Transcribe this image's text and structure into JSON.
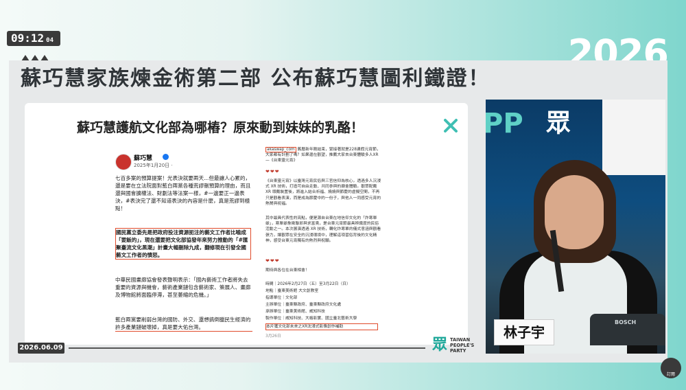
{
  "clock": {
    "time": "09:12",
    "seconds": "04"
  },
  "year_logo": "2026",
  "headline": "蘇巧慧家族煉金術第二部 公布蘇巧慧圖利鐵證！",
  "card": {
    "title": "蘇巧慧護航文化部為哪樁？原來動到妹妹的乳酪！",
    "close_icon": "close-icon",
    "fb_post": {
      "author": "蘇巧慧",
      "date": "2025年1月20日 · ",
      "p1": "七百多案的預算提案！光表決就要兩天...但最讓人心累的，還是要在立法院面對藍白兩黨各種荒謬刪預算的理由，而且還與國會擴權法、財劃法等法案一樣，#一邊要正一邊表決，#表決完了還不知道表決的內容是什麼，真是荒謬到極點！",
      "p2": "國民黨立委先是把政府投注資源扼注的藝文工作者比喻成「要飯的」，現在還要把文化部協發年來努力推動的「#匯聚臺流文化黑潮」計畫大幅刪除九成，翻修現在引發全國藝文工作者的憤怒。",
      "p3": "中華民國畫廊協會發表聲明表示：「國內藝術工作者將失去重要的資源與機會，藝術產業鏈包含藝術家、策展人、畫廊及博物館將面臨停滯，甚至萎縮的危機。」",
      "p4": "藍白兩黨要削弱台灣的國防、外交、還想搞倒臘民生經濟的許多產業鏈破壞掉，真是要大佑台灣。"
    },
    "event_post": {
      "link": "akaswap_com",
      "intro": "舊曆新年剛結束，緊接著就是228連假元宵節，大家都有計劃了嗎？如果還在觀望，推薦大家去台東體驗多人XR—《台東靈元宵》",
      "hearts": "❤❤❤",
      "desc1": "《台東靈元宵》以臺灣元宵民俗與三官信仰為核心，透過多人沉浸式 XR 技術，打造可自由走動、共同參與的廟會體驗。觀眾配戴 XR 頭戴裝置後，將進入結合祈福、燒燒與節慶的虛擬空間，不再只是觀看表演，而是成為節慶中的一份子，與他人一同感受元宵的熱鬧與祝福。",
      "desc2": "其中最具代表性的亮點，便是源自台東在地信仰文化的「炸寒單爺」，寒單爺象徵聯邪與求富貴，是台東元宵節最具辨識度的民俗活動之一。本次展演透過 XR 技術，轉化炸寒單的儀式意涵與觀看張力，讓觀眾在安全的沉浸環境中，理解這項習俗背後的文化精神，感受台東元宵獨有的熱烈與祝願。",
      "hearts2": "❤❤❤",
      "cta": "期待與各位在台東相會！",
      "schedule": "時間｜2026年2月27日（五）至3月22日（日）",
      "venue": "地點｜臺東美術館 大文創教室",
      "guide": "指導單位｜文化部",
      "host": "主辦單位｜臺東縣政府、臺東縣政府文化處",
      "organizer": "承辦單位｜臺東美術館、威知科技",
      "producer": "製作單位｜威知科技、大格影實、國立臺北藝術大學",
      "highlight": "本片獲文化部未來之XR沈浸式影像創作補助",
      "footer": "3月26日"
    }
  },
  "photo": {
    "wall_text_left": "PP",
    "wall_text_mid": "眾",
    "nameplate": "林子宇",
    "mic_brand": "BOSCH"
  },
  "footer": {
    "date": "2026.06.09",
    "party_logo": "眾",
    "party_name_1": "TAIWAN",
    "party_name_2": "PEOPLE'S",
    "party_name_3": "PARTY",
    "station_label": "訂閱"
  }
}
